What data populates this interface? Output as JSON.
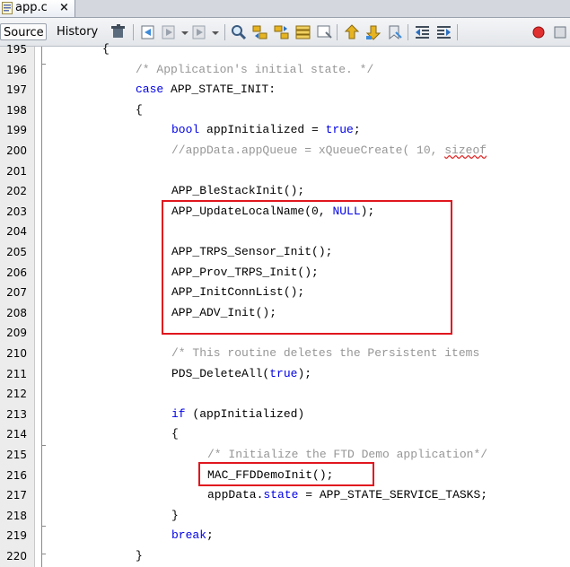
{
  "tab": {
    "title": "app.c",
    "close": "×"
  },
  "toolbar": {
    "source": "Source",
    "history": "History",
    "icons": [
      "last-edit-icon",
      "back-icon",
      "forward-dropdown-icon",
      "forward-icon",
      "find-icon",
      "find-previous-icon",
      "find-next-icon",
      "toggle-highlight-icon",
      "find-selection-icon",
      "previous-bookmark-icon",
      "next-bookmark-icon",
      "toggle-bookmark-icon",
      "shift-left-icon",
      "shift-right-icon",
      "start-macro-icon",
      "stop-macro-icon"
    ]
  },
  "editor": {
    "lines": [
      {
        "num": "195",
        "text": "{"
      },
      {
        "num": "196",
        "text": "/* Application's initial state. */"
      },
      {
        "num": "197",
        "text": "case APP_STATE_INIT:"
      },
      {
        "num": "198",
        "text": "{"
      },
      {
        "num": "199",
        "text": "bool appInitialized = true;"
      },
      {
        "num": "200",
        "text": "//appData.appQueue = xQueueCreate( 10, sizeof"
      },
      {
        "num": "201",
        "text": ""
      },
      {
        "num": "202",
        "text": "APP_BleStackInit();"
      },
      {
        "num": "203",
        "text": "APP_UpdateLocalName(0, NULL);"
      },
      {
        "num": "204",
        "text": ""
      },
      {
        "num": "205",
        "text": "APP_TRPS_Sensor_Init();"
      },
      {
        "num": "206",
        "text": "APP_Prov_TRPS_Init();"
      },
      {
        "num": "207",
        "text": "APP_InitConnList();"
      },
      {
        "num": "208",
        "text": "APP_ADV_Init();"
      },
      {
        "num": "209",
        "text": ""
      },
      {
        "num": "210",
        "text": "/* This routine deletes the Persistent items"
      },
      {
        "num": "211",
        "text": "PDS_DeleteAll(true);"
      },
      {
        "num": "212",
        "text": ""
      },
      {
        "num": "213",
        "text": "if (appInitialized)"
      },
      {
        "num": "214",
        "text": "{"
      },
      {
        "num": "215",
        "text": "/* Initialize the FTD Demo application*/"
      },
      {
        "num": "216",
        "text": "MAC_FFDDemoInit();"
      },
      {
        "num": "217",
        "text": "appData.state = APP_STATE_SERVICE_TASKS;"
      },
      {
        "num": "218",
        "text": "}"
      },
      {
        "num": "219",
        "text": "break;"
      },
      {
        "num": "220",
        "text": "}"
      }
    ]
  },
  "colors": {
    "keyword": "#0000e6",
    "comment": "#969696",
    "highlight_box": "#e0161e"
  }
}
